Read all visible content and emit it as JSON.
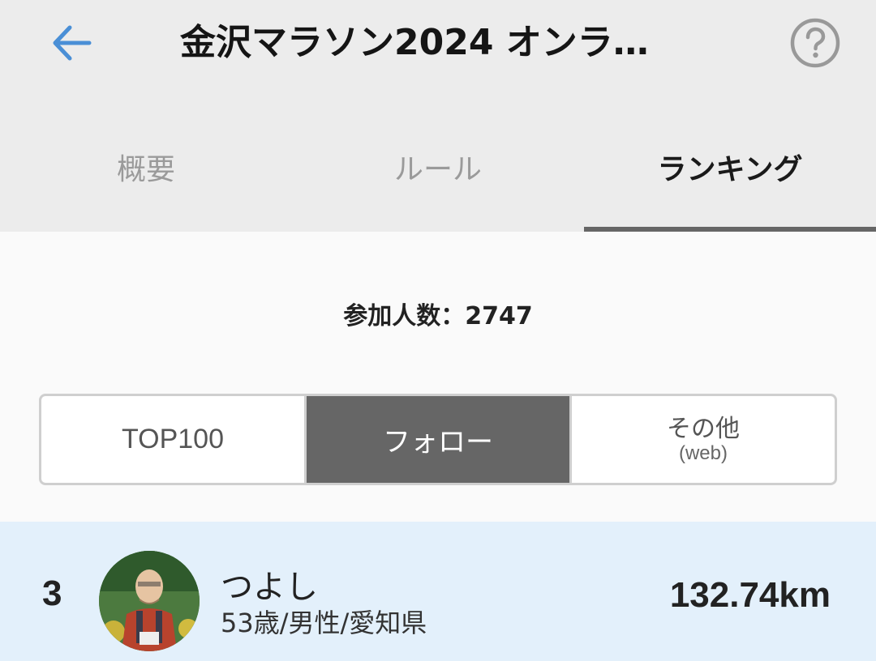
{
  "header": {
    "title": "金沢マラソン2024 オンラ…",
    "back_icon": "arrow-left-icon",
    "help_icon": "question-circle-icon",
    "accent_color": "#4a8fd6"
  },
  "tabs": [
    {
      "label": "概要",
      "active": false
    },
    {
      "label": "ルール",
      "active": false
    },
    {
      "label": "ランキング",
      "active": true
    }
  ],
  "participants": {
    "text": "参加人数：2747"
  },
  "segments": [
    {
      "label": "TOP100",
      "active": false
    },
    {
      "label": "フォロー",
      "active": true
    },
    {
      "label": "その他",
      "sub_label": "(web)",
      "active": false
    }
  ],
  "ranking": [
    {
      "rank": "3",
      "name": "つよし",
      "meta": "53歳/男性/愛知県",
      "distance": "132.74km"
    }
  ]
}
